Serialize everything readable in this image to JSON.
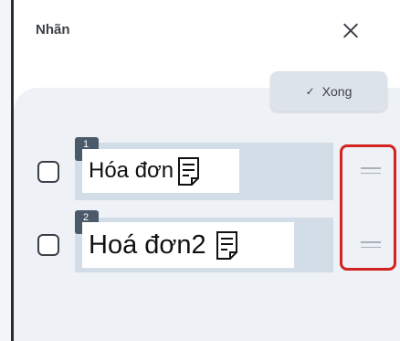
{
  "header": {
    "title": "Nhãn",
    "close_icon": "close-icon"
  },
  "toolbar": {
    "done_label": "Xong",
    "done_icon": "check-icon"
  },
  "labels": [
    {
      "index": "1",
      "text": "Hóa đơn",
      "icon": "document-icon"
    },
    {
      "index": "2",
      "text": "Hoá đơn2",
      "icon": "document-icon"
    }
  ],
  "colors": {
    "highlight": "#d32424",
    "row_background": "#d3dde7",
    "badge": "#4b5a6b"
  }
}
